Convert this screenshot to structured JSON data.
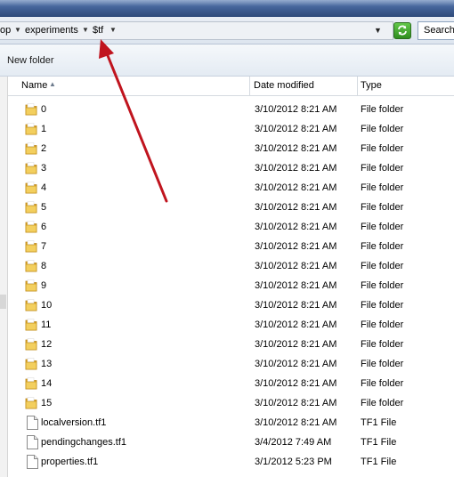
{
  "address": {
    "crumbs": [
      {
        "label": "op"
      },
      {
        "label": "experiments"
      },
      {
        "label": "$tf"
      }
    ]
  },
  "search": {
    "placeholder": "Search"
  },
  "toolbar": {
    "new_folder_label": "New folder"
  },
  "columns": {
    "name": "Name",
    "date": "Date modified",
    "type": "Type"
  },
  "files": [
    {
      "name": "0",
      "date": "3/10/2012 8:21 AM",
      "type": "File folder",
      "kind": "folder"
    },
    {
      "name": "1",
      "date": "3/10/2012 8:21 AM",
      "type": "File folder",
      "kind": "folder"
    },
    {
      "name": "2",
      "date": "3/10/2012 8:21 AM",
      "type": "File folder",
      "kind": "folder"
    },
    {
      "name": "3",
      "date": "3/10/2012 8:21 AM",
      "type": "File folder",
      "kind": "folder"
    },
    {
      "name": "4",
      "date": "3/10/2012 8:21 AM",
      "type": "File folder",
      "kind": "folder"
    },
    {
      "name": "5",
      "date": "3/10/2012 8:21 AM",
      "type": "File folder",
      "kind": "folder"
    },
    {
      "name": "6",
      "date": "3/10/2012 8:21 AM",
      "type": "File folder",
      "kind": "folder"
    },
    {
      "name": "7",
      "date": "3/10/2012 8:21 AM",
      "type": "File folder",
      "kind": "folder"
    },
    {
      "name": "8",
      "date": "3/10/2012 8:21 AM",
      "type": "File folder",
      "kind": "folder"
    },
    {
      "name": "9",
      "date": "3/10/2012 8:21 AM",
      "type": "File folder",
      "kind": "folder"
    },
    {
      "name": "10",
      "date": "3/10/2012 8:21 AM",
      "type": "File folder",
      "kind": "folder"
    },
    {
      "name": "11",
      "date": "3/10/2012 8:21 AM",
      "type": "File folder",
      "kind": "folder"
    },
    {
      "name": "12",
      "date": "3/10/2012 8:21 AM",
      "type": "File folder",
      "kind": "folder"
    },
    {
      "name": "13",
      "date": "3/10/2012 8:21 AM",
      "type": "File folder",
      "kind": "folder"
    },
    {
      "name": "14",
      "date": "3/10/2012 8:21 AM",
      "type": "File folder",
      "kind": "folder"
    },
    {
      "name": "15",
      "date": "3/10/2012 8:21 AM",
      "type": "File folder",
      "kind": "folder"
    },
    {
      "name": "localversion.tf1",
      "date": "3/10/2012 8:21 AM",
      "type": "TF1 File",
      "kind": "file"
    },
    {
      "name": "pendingchanges.tf1",
      "date": "3/4/2012 7:49 AM",
      "type": "TF1 File",
      "kind": "file"
    },
    {
      "name": "properties.tf1",
      "date": "3/1/2012 5:23 PM",
      "type": "TF1 File",
      "kind": "file"
    }
  ],
  "icons": {
    "folder": "folder-icon",
    "file": "file-icon",
    "breadcrumb_separator": "chevron-down-icon",
    "refresh": "refresh-icon",
    "sort": "sort-ascending-icon"
  },
  "colors": {
    "annotation_arrow": "#c0141e",
    "folder": "#e8b83a"
  }
}
